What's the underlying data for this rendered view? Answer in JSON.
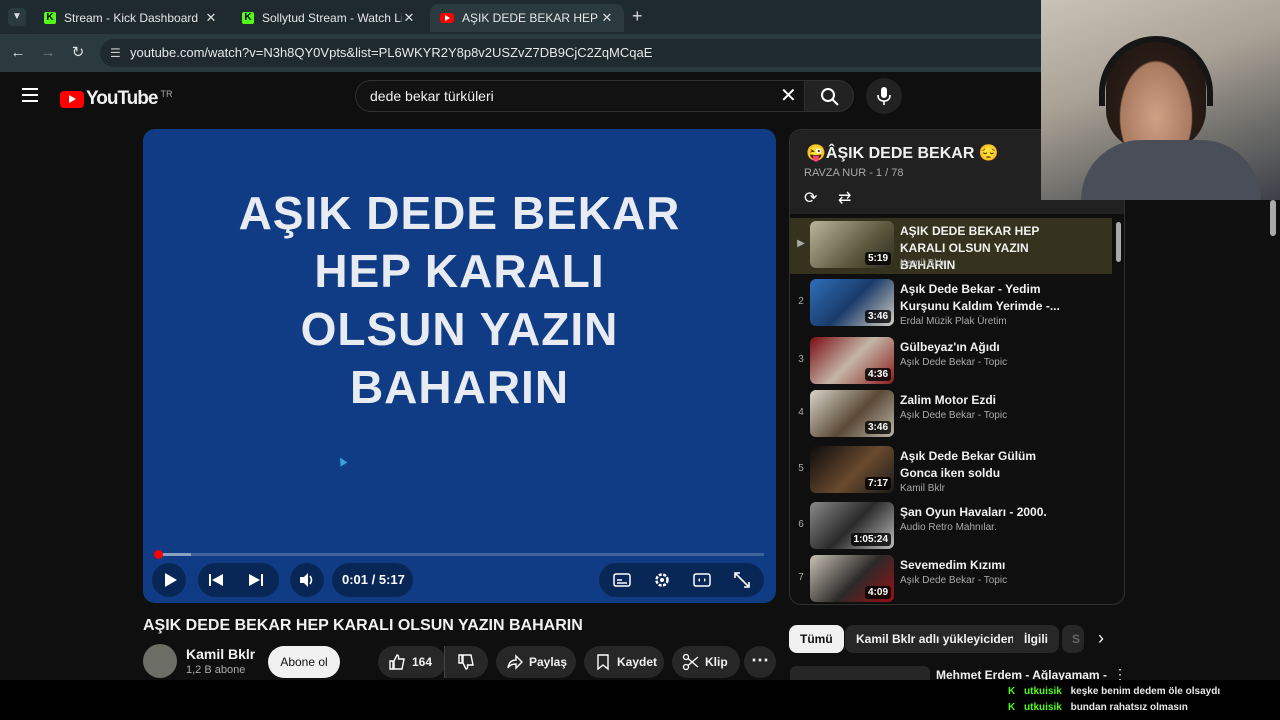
{
  "browser": {
    "tabs": [
      {
        "title": "Stream - Kick Dashboard",
        "icon": "kick-icon"
      },
      {
        "title": "Sollytud Stream - Watch Live o",
        "icon": "kick-icon"
      },
      {
        "title": "AŞIK DEDE BEKAR HEP KARALI",
        "icon": "youtube-icon"
      }
    ],
    "url": "youtube.com/watch?v=N3h8QY0Vpts&list=PL6WKYR2Y8p8v2USZvZ7DB9CjC2ZqMCqaE"
  },
  "youtube": {
    "logo_text": "YouTube",
    "country_code": "TR",
    "search_value": "dede bekar türküleri"
  },
  "player": {
    "overlay_text": [
      "AŞIK DEDE BEKAR",
      "HEP KARALI",
      "OLSUN YAZIN",
      "BAHARIN"
    ],
    "time": "0:01 / 5:17",
    "progress": 0.003
  },
  "video": {
    "title": "AŞIK DEDE BEKAR HEP KARALI OLSUN YAZIN BAHARIN",
    "channel": "Kamil Bklr",
    "subscribers": "1,2 B abone",
    "subscribe_label": "Abone ol",
    "likes": "164",
    "share_label": "Paylaş",
    "save_label": "Kaydet",
    "clip_label": "Klip"
  },
  "playlist": {
    "title": "😜ÂŞIK DEDE BEKAR 😔",
    "subtitle": "RAVZA NUR - 1 / 78",
    "items": [
      {
        "index": "▶",
        "title": "AŞIK DEDE BEKAR HEP KARALI OLSUN YAZIN BAHARIN",
        "channel": "Kamil Bklr",
        "duration": "5:19",
        "current": true
      },
      {
        "index": "2",
        "title": "Aşık Dede Bekar - Yedim Kurşunu Kaldım Yerimde -...",
        "channel": "Erdal Müzik Plak Üretim",
        "duration": "3:46"
      },
      {
        "index": "3",
        "title": "Gülbeyaz'ın Ağıdı",
        "channel": "Aşık Dede Bekar - Topic",
        "duration": "4:36"
      },
      {
        "index": "4",
        "title": "Zalim Motor Ezdi",
        "channel": "Aşık Dede Bekar - Topic",
        "duration": "3:46"
      },
      {
        "index": "5",
        "title": "Aşık Dede Bekar Gülüm Gonca iken soldu",
        "channel": "Kamil Bklr",
        "duration": "7:17"
      },
      {
        "index": "6",
        "title": "Şan Oyun Havaları - 2000.",
        "channel": "Audio Retro Mahnılar.",
        "duration": "1:05:24"
      },
      {
        "index": "7",
        "title": "Sevemedim Kızımı",
        "channel": "Aşık Dede Bekar - Topic",
        "duration": "4:09"
      }
    ]
  },
  "chips": [
    "Tümü",
    "Kamil Bklr adlı yükleyiciden",
    "İlgili",
    "S"
  ],
  "next_video_title": "Mehmet Erdem - Ağlayamam -",
  "chat": [
    {
      "user": "utkuisik",
      "message": "keşke benim dedem öle olsaydı"
    },
    {
      "user": "utkuisik",
      "message": "bundan rahatsız olmasın"
    }
  ]
}
